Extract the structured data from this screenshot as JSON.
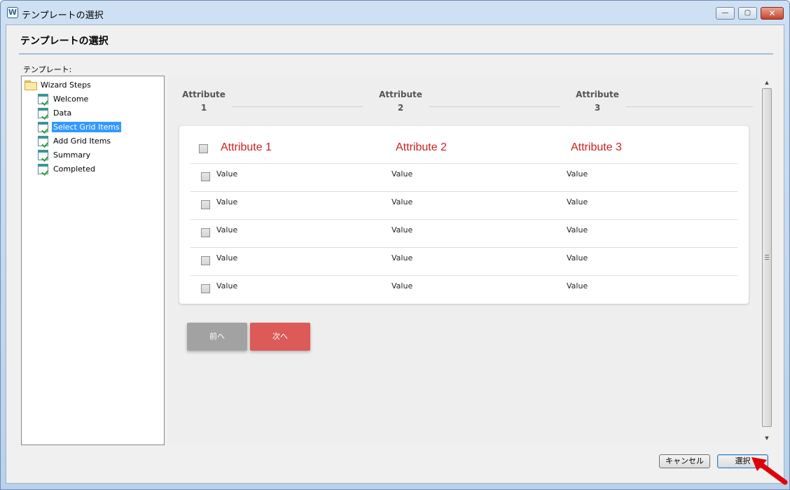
{
  "window": {
    "title": "テンプレートの選択",
    "minimize_glyph": "—",
    "maximize_glyph": "▢",
    "close_glyph": "✕"
  },
  "header": {
    "title": "テンプレートの選択",
    "template_label": "テンプレート:"
  },
  "tree": {
    "root": "Wizard Steps",
    "items": [
      {
        "label": "Welcome",
        "selected": false
      },
      {
        "label": "Data",
        "selected": false
      },
      {
        "label": "Select Grid Items",
        "selected": true
      },
      {
        "label": "Add Grid Items",
        "selected": false
      },
      {
        "label": "Summary",
        "selected": false
      },
      {
        "label": "Completed",
        "selected": false
      }
    ]
  },
  "preview": {
    "steps": [
      {
        "title": "Attribute",
        "number": "1"
      },
      {
        "title": "Attribute",
        "number": "2"
      },
      {
        "title": "Attribute",
        "number": "3"
      }
    ],
    "grid": {
      "headers": [
        "Attribute 1",
        "Attribute 2",
        "Attribute 3"
      ],
      "rows": [
        [
          "Value",
          "Value",
          "Value"
        ],
        [
          "Value",
          "Value",
          "Value"
        ],
        [
          "Value",
          "Value",
          "Value"
        ],
        [
          "Value",
          "Value",
          "Value"
        ],
        [
          "Value",
          "Value",
          "Value"
        ]
      ]
    },
    "prev_label": "前へ",
    "next_label": "次へ"
  },
  "buttons": {
    "cancel": "キャンセル",
    "select": "選択"
  },
  "colors": {
    "accent_red": "#cc1f1f",
    "next_button": "#dc5a57",
    "prev_button": "#a2a2a2",
    "selection": "#3399ff"
  },
  "icons": {
    "app": "app-logo-icon",
    "folder": "folder-icon",
    "step_page": "page-check-icon",
    "annotation": "red-arrow-pointer"
  }
}
